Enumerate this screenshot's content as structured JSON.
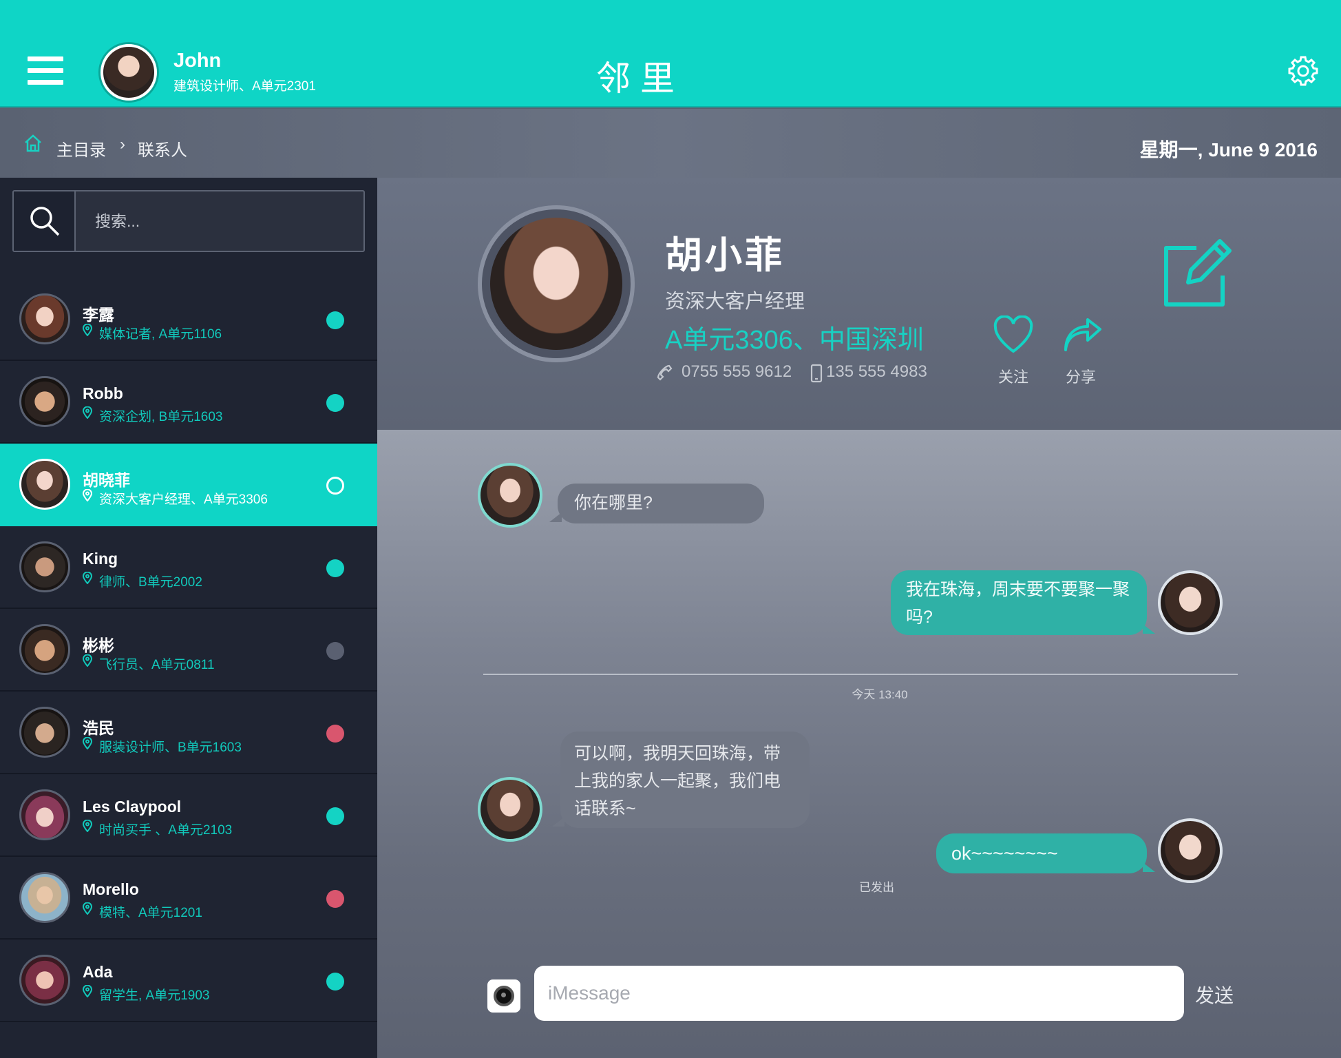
{
  "header": {
    "user_name": "John",
    "user_subtitle": "建筑设计师、A单元2301",
    "app_title": "邻里"
  },
  "breadcrumb": {
    "home": "主目录",
    "separator": "›",
    "current": "联系人"
  },
  "date": "星期一, June 9  2016",
  "search": {
    "placeholder": "搜索..."
  },
  "contacts": [
    {
      "name": "李露",
      "subtitle": "媒体记者, A单元1106",
      "status_color": "#14d3c4"
    },
    {
      "name": "Robb",
      "subtitle": "资深企划, B单元1603",
      "status_color": "#14d3c4"
    },
    {
      "name": "胡晓菲",
      "subtitle": "资深大客户经理、A单元3306",
      "status_color": "outline"
    },
    {
      "name": "King",
      "subtitle": "律师、B单元2002",
      "status_color": "#14d3c4"
    },
    {
      "name": "彬彬",
      "subtitle": "飞行员、A单元0811",
      "status_color": "#5a6071"
    },
    {
      "name": "浩民",
      "subtitle": "服装设计师、B单元1603",
      "status_color": "#d9566e"
    },
    {
      "name": "Les Claypool",
      "subtitle": "时尚买手 、A单元2103",
      "status_color": "#14d3c4"
    },
    {
      "name": "Morello",
      "subtitle": "模特、A单元1201",
      "status_color": "#d9566e"
    },
    {
      "name": "Ada",
      "subtitle": "留学生, A单元1903",
      "status_color": "#14d3c4"
    }
  ],
  "profile": {
    "name": "胡小菲",
    "role": "资深大客户经理",
    "location": "A单元3306、中国深圳",
    "phone": "0755 555 9612",
    "mobile": "135 555 4983",
    "follow_label": "关注",
    "share_label": "分享"
  },
  "chat": {
    "messages": [
      {
        "from": "them",
        "text": "你在哪里?"
      },
      {
        "from": "me",
        "text": "我在珠海，周末要不要聚一聚吗?"
      },
      {
        "from": "them",
        "text": "可以啊，我明天回珠海，带上我的家人一起聚，我们电话联系~"
      },
      {
        "from": "me",
        "text": "ok~~~~~~~~"
      }
    ],
    "timestamp": "今天      13:40",
    "sent_status": "已发出",
    "input_placeholder": "iMessage",
    "send_label": "发送"
  },
  "colors": {
    "accent": "#0fd5c6",
    "sidebar_bg": "#1f2432",
    "status_online": "#14d3c4",
    "status_busy": "#d9566e",
    "status_offline": "#5a6071"
  },
  "icons": [
    "menu-icon",
    "gear-icon",
    "home-icon",
    "search-icon",
    "location-pin-icon",
    "phone-icon",
    "mobile-icon",
    "heart-icon",
    "share-icon",
    "edit-icon",
    "camera-icon"
  ]
}
